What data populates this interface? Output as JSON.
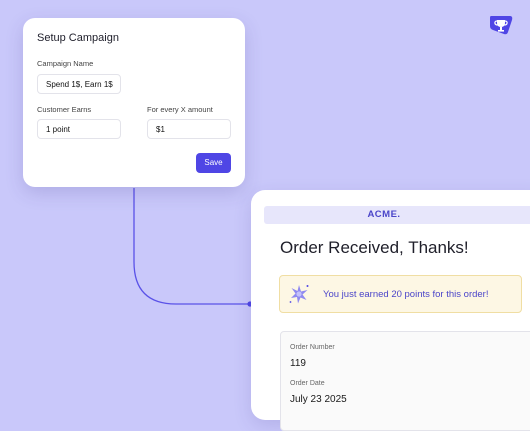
{
  "setup": {
    "title": "Setup Campaign",
    "campaign_name_label": "Campaign Name",
    "campaign_name_value": "Spend 1$, Earn 1$",
    "customer_earns_label": "Customer Earns",
    "customer_earns_value": "1 point",
    "every_amount_label": "For every X amount",
    "every_amount_value": "$1",
    "save_label": "Save"
  },
  "receipt": {
    "brand": "ACME.",
    "heading": "Order Received, Thanks!",
    "notice": "You just earned 20 points for this order!",
    "order_number_label": "Order Number",
    "order_number_value": "119",
    "order_date_label": "Order Date",
    "order_date_value": "July 23 2025"
  },
  "icons": {
    "app_logo": "trophy-badge-icon",
    "notice_icon": "sparkle-icon"
  },
  "colors": {
    "background": "#c9c8fa",
    "accent": "#4f46e5",
    "notice_bg": "#fdf7e4"
  }
}
